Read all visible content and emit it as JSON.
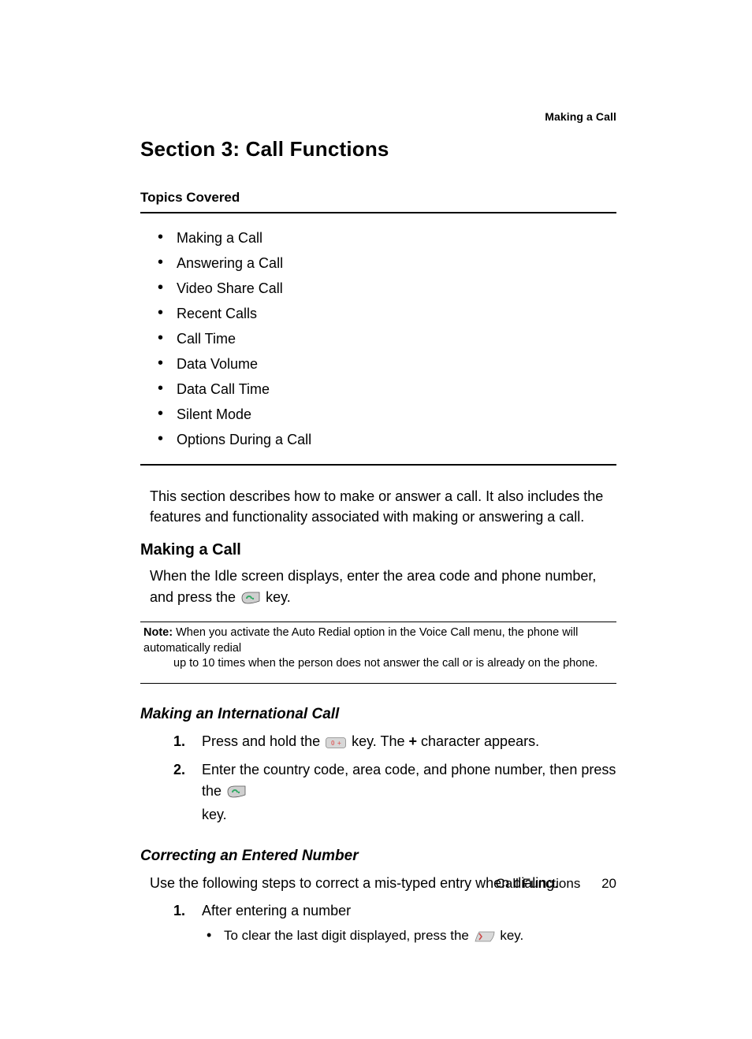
{
  "header": {
    "running_head": "Making a Call"
  },
  "section": {
    "title": "Section 3:  Call Functions",
    "topics_heading": "Topics Covered",
    "topics": [
      "Making a Call",
      "Answering a Call",
      "",
      "Video Share Call",
      "Recent Calls",
      "Call Time",
      "Data Volume",
      "Data Call Time",
      "Silent Mode",
      "Options During a Call"
    ],
    "intro": "This section describes how to make or answer a call. It also includes the features and functionality associated with making or answering a call."
  },
  "making_a_call": {
    "heading": "Making a Call",
    "para_before": "When the Idle screen displays, enter the area code and phone number, and press the ",
    "para_after": " key.",
    "note_label": "Note:",
    "note_line1_rest": " When you activate the Auto Redial option in the Voice Call menu, the phone will automatically redial",
    "note_line2": "up to 10 times when the person does not answer the call or is already on the phone."
  },
  "international": {
    "heading": "Making an International Call",
    "step1_before": "Press and hold the ",
    "step1_mid": " key. The ",
    "step1_plus": "+",
    "step1_after": " character appears.",
    "step2_before": "Enter the country code, area code, and phone number, then press the ",
    "step2_after": "key."
  },
  "correcting": {
    "heading": "Correcting an Entered Number",
    "intro": "Use the following steps to correct a mis-typed entry when dialing.",
    "step1": "After entering a number",
    "sub_before": "To clear the last digit displayed, press the ",
    "sub_after": " key."
  },
  "footer": {
    "section_name": "Call Functions",
    "page_number": "20"
  },
  "steps": {
    "n1": "1.",
    "n2": "2."
  }
}
